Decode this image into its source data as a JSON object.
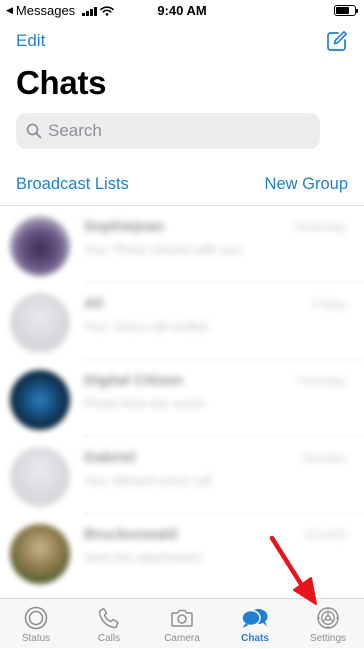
{
  "status_bar": {
    "back_glyph": "◀",
    "carrier": "Messages",
    "time": "9:40 AM",
    "signal_bars": 4,
    "battery_level": 0.7
  },
  "header": {
    "edit_label": "Edit",
    "compose_icon": "compose-icon",
    "title": "Chats"
  },
  "search": {
    "placeholder": "Search"
  },
  "links": {
    "broadcast": "Broadcast Lists",
    "new_group": "New Group"
  },
  "chats": [
    {
      "name": "Sophiejean",
      "msg": "You: Photo shared with you",
      "time": "Yesterday",
      "avatar": "#5a4a7a"
    },
    {
      "name": "Ali",
      "msg": "You: Voice call ended",
      "time": "Friday",
      "avatar": "#d5d5d8"
    },
    {
      "name": "Digital Citizen",
      "msg": "Photo from the event",
      "time": "Thursday",
      "avatar": "#1c4b73"
    },
    {
      "name": "Gabriel",
      "msg": "You: Missed voice call",
      "time": "Monday",
      "avatar": "#d5d5d8"
    },
    {
      "name": "Bruckenwald",
      "msg": "Sent the attachment",
      "time": "9/14/20",
      "avatar": "#8a7a4a"
    }
  ],
  "tabbar": {
    "status": "Status",
    "calls": "Calls",
    "camera": "Camera",
    "chats": "Chats",
    "settings": "Settings",
    "accent": "#1f7fd0",
    "inactive": "#8e8e93"
  },
  "annotation": {
    "arrow_color": "#e8141b",
    "target": "settings-tab"
  }
}
